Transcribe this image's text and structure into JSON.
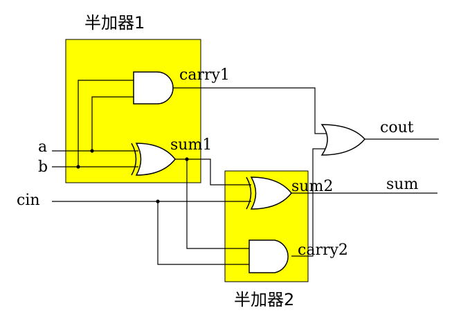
{
  "colors": {
    "block_fill": "#ffff00",
    "wire": "#000000",
    "background": "#ffffff"
  },
  "blocks": [
    {
      "title": "半加器1"
    },
    {
      "title": "半加器2"
    }
  ],
  "inputs": {
    "a": "a",
    "b": "b",
    "cin": "cin"
  },
  "signals": {
    "carry1": "carry1",
    "sum1": "sum1",
    "sum2": "sum2",
    "carry2": "carry2"
  },
  "outputs": {
    "cout": "cout",
    "sum": "sum"
  },
  "gates": [
    {
      "type": "and",
      "block": "半加器1"
    },
    {
      "type": "xor",
      "block": "半加器1"
    },
    {
      "type": "xor",
      "block": "半加器2"
    },
    {
      "type": "and",
      "block": "半加器2"
    },
    {
      "type": "or",
      "block": ""
    }
  ]
}
